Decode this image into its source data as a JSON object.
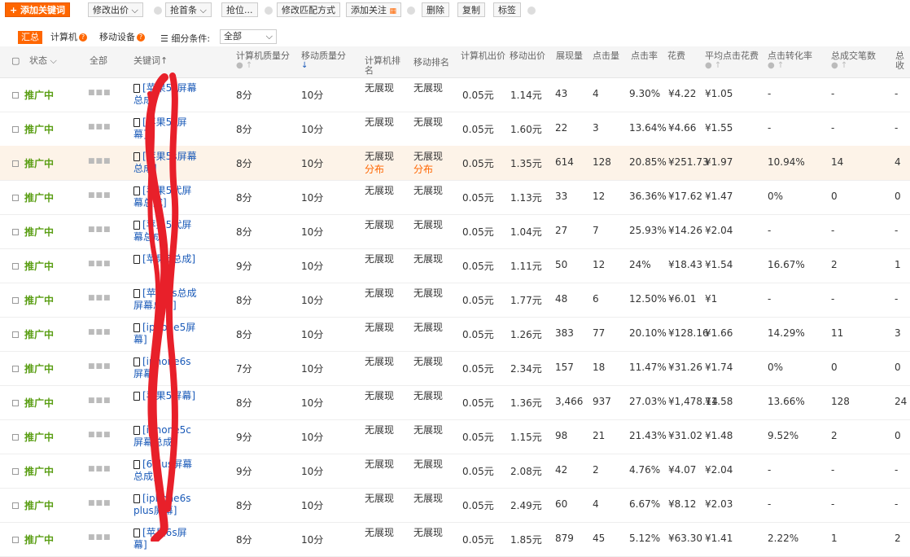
{
  "toolbar": {
    "add": "+ 添加关键词",
    "modify_bid": "修改出价",
    "grab_first": "抢首条",
    "grab_pos": "抢位...",
    "modify_match": "修改匹配方式",
    "add_follow": "添加关注",
    "delete": "删除",
    "copy": "复制",
    "tag": "标签"
  },
  "subtabs": {
    "summary": "汇总",
    "computer": "计算机",
    "mobile": "移动设备",
    "filter_label": "细分条件:",
    "filter_value": "全部"
  },
  "headers": {
    "status": "状态",
    "all": "全部",
    "keyword": "关键词",
    "pc_quality": "计算机质量分",
    "mobile_quality": "移动质量分",
    "pc_rank": "计算机排名",
    "mobile_rank": "移动排名",
    "pc_bid": "计算机出价",
    "mobile_bid": "移动出价",
    "impressions": "展现量",
    "clicks": "点击量",
    "ctr": "点击率",
    "cost": "花费",
    "avg_cpc": "平均点击花费",
    "conv_rate": "点击转化率",
    "orders": "总成交笔数",
    "collect": "总收"
  },
  "rows": [
    {
      "status": "推广中",
      "kw": "[苹果5s屏幕总成]",
      "pcq": "8分",
      "mq": "10分",
      "pcr": "无展现",
      "mr": "无展现",
      "pcb": "0.05元",
      "mb": "1.14元",
      "imp": "43",
      "clk": "4",
      "ctr": "9.30%",
      "cost": "¥4.22",
      "cpc": "¥1.05",
      "conv": "-",
      "orders": "-",
      "col": "-"
    },
    {
      "status": "推广中",
      "kw": "[苹果5s屏幕]",
      "pcq": "8分",
      "mq": "10分",
      "pcr": "无展现",
      "mr": "无展现",
      "pcb": "0.05元",
      "mb": "1.60元",
      "imp": "22",
      "clk": "3",
      "ctr": "13.64%",
      "cost": "¥4.66",
      "cpc": "¥1.55",
      "conv": "-",
      "orders": "-",
      "col": "-"
    },
    {
      "status": "推广中",
      "kw": "[苹果5s屏幕总成]",
      "pcq": "8分",
      "mq": "10分",
      "pcr": "无展现",
      "mr": "无展现",
      "pcr2": "分布",
      "mr2": "分布",
      "pcb": "0.05元",
      "mb": "1.35元",
      "imp": "614",
      "clk": "128",
      "ctr": "20.85%",
      "cost": "¥251.73",
      "cpc": "¥1.97",
      "conv": "10.94%",
      "orders": "14",
      "col": "4"
    },
    {
      "status": "推广中",
      "kw": "[苹果5代屏幕总成]",
      "pcq": "8分",
      "mq": "10分",
      "pcr": "无展现",
      "mr": "无展现",
      "pcb": "0.05元",
      "mb": "1.13元",
      "imp": "33",
      "clk": "12",
      "ctr": "36.36%",
      "cost": "¥17.62",
      "cpc": "¥1.47",
      "conv": "0%",
      "orders": "0",
      "col": "0"
    },
    {
      "status": "推广中",
      "kw": "[苹果5代屏幕总成]",
      "pcq": "8分",
      "mq": "10分",
      "pcr": "无展现",
      "mr": "无展现",
      "pcb": "0.05元",
      "mb": "1.04元",
      "imp": "27",
      "clk": "7",
      "ctr": "25.93%",
      "cost": "¥14.26",
      "cpc": "¥2.04",
      "conv": "-",
      "orders": "-",
      "col": "-"
    },
    {
      "status": "推广中",
      "kw": "[苹果5总成]",
      "pcq": "9分",
      "mq": "10分",
      "pcr": "无展现",
      "mr": "无展现",
      "pcb": "0.05元",
      "mb": "1.11元",
      "imp": "50",
      "clk": "12",
      "ctr": "24%",
      "cost": "¥18.43",
      "cpc": "¥1.54",
      "conv": "16.67%",
      "orders": "2",
      "col": "1"
    },
    {
      "status": "推广中",
      "kw": "[苹果5s总成屏幕总成]",
      "pcq": "8分",
      "mq": "10分",
      "pcr": "无展现",
      "mr": "无展现",
      "pcb": "0.05元",
      "mb": "1.77元",
      "imp": "48",
      "clk": "6",
      "ctr": "12.50%",
      "cost": "¥6.01",
      "cpc": "¥1",
      "conv": "-",
      "orders": "-",
      "col": "-"
    },
    {
      "status": "推广中",
      "kw": "[iphone5屏幕]",
      "pcq": "8分",
      "mq": "10分",
      "pcr": "无展现",
      "mr": "无展现",
      "pcb": "0.05元",
      "mb": "1.26元",
      "imp": "383",
      "clk": "77",
      "ctr": "20.10%",
      "cost": "¥128.16",
      "cpc": "¥1.66",
      "conv": "14.29%",
      "orders": "11",
      "col": "3"
    },
    {
      "status": "推广中",
      "kw": "[iphone6s屏幕]",
      "pcq": "7分",
      "mq": "10分",
      "pcr": "无展现",
      "mr": "无展现",
      "pcb": "0.05元",
      "mb": "2.34元",
      "imp": "157",
      "clk": "18",
      "ctr": "11.47%",
      "cost": "¥31.26",
      "cpc": "¥1.74",
      "conv": "0%",
      "orders": "0",
      "col": "0"
    },
    {
      "status": "推广中",
      "kw": "[苹果5屏幕]",
      "pcq": "8分",
      "mq": "10分",
      "pcr": "无展现",
      "mr": "无展现",
      "pcb": "0.05元",
      "mb": "1.36元",
      "imp": "3,466",
      "clk": "937",
      "ctr": "27.03%",
      "cost": "¥1,478.14",
      "cpc": "¥1.58",
      "conv": "13.66%",
      "orders": "128",
      "col": "24"
    },
    {
      "status": "推广中",
      "kw": "[iphone5c屏幕总成]",
      "pcq": "9分",
      "mq": "10分",
      "pcr": "无展现",
      "mr": "无展现",
      "pcb": "0.05元",
      "mb": "1.15元",
      "imp": "98",
      "clk": "21",
      "ctr": "21.43%",
      "cost": "¥31.02",
      "cpc": "¥1.48",
      "conv": "9.52%",
      "orders": "2",
      "col": "0"
    },
    {
      "status": "推广中",
      "kw": "[6plus屏幕总成]",
      "pcq": "9分",
      "mq": "10分",
      "pcr": "无展现",
      "mr": "无展现",
      "pcb": "0.05元",
      "mb": "2.08元",
      "imp": "42",
      "clk": "2",
      "ctr": "4.76%",
      "cost": "¥4.07",
      "cpc": "¥2.04",
      "conv": "-",
      "orders": "-",
      "col": "-"
    },
    {
      "status": "推广中",
      "kw": "[iphone6s plus屏幕]",
      "pcq": "8分",
      "mq": "10分",
      "pcr": "无展现",
      "mr": "无展现",
      "pcb": "0.05元",
      "mb": "2.49元",
      "imp": "60",
      "clk": "4",
      "ctr": "6.67%",
      "cost": "¥8.12",
      "cpc": "¥2.03",
      "conv": "-",
      "orders": "-",
      "col": "-"
    },
    {
      "status": "推广中",
      "kw": "[苹果6s屏幕]",
      "pcq": "8分",
      "mq": "10分",
      "pcr": "无展现",
      "mr": "无展现",
      "pcb": "0.05元",
      "mb": "1.85元",
      "imp": "879",
      "clk": "45",
      "ctr": "5.12%",
      "cost": "¥63.30",
      "cpc": "¥1.41",
      "conv": "2.22%",
      "orders": "1",
      "col": "2"
    }
  ]
}
